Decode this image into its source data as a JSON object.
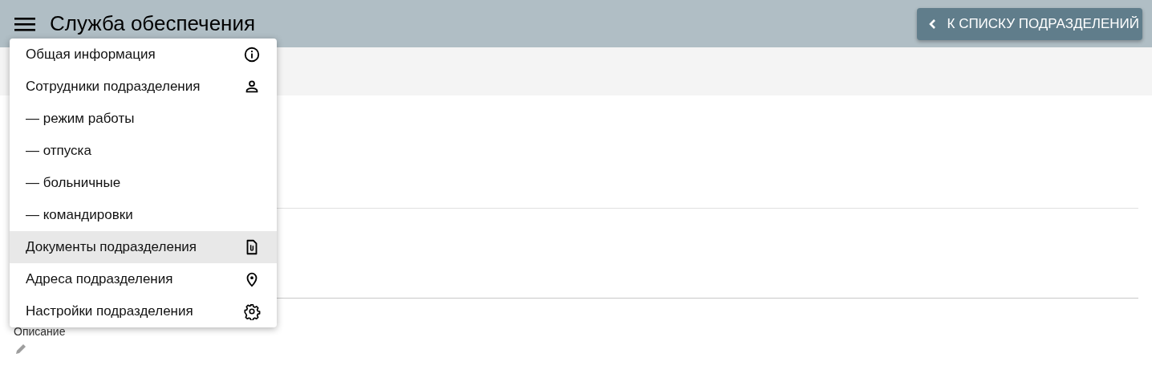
{
  "header": {
    "title": "Служба обеспечения",
    "back_button": "К СПИСКУ ПОДРАЗДЕЛЕНИЙ"
  },
  "menu": {
    "items": [
      {
        "label": "Общая информация",
        "kind": "info",
        "selected": false
      },
      {
        "label": "Сотрудники подразделения",
        "kind": "person",
        "selected": false
      },
      {
        "label": "— режим работы",
        "kind": "plain",
        "selected": false
      },
      {
        "label": "— отпуска",
        "kind": "plain",
        "selected": false
      },
      {
        "label": "— больничные",
        "kind": "plain",
        "selected": false
      },
      {
        "label": "— командировки",
        "kind": "plain",
        "selected": false
      },
      {
        "label": "Документы подразделения",
        "kind": "document",
        "selected": true
      },
      {
        "label": "Адреса подразделения",
        "kind": "address",
        "selected": false
      },
      {
        "label": "Настройки подразделения",
        "kind": "settings",
        "selected": false
      }
    ]
  },
  "description": {
    "label": "Описание"
  }
}
